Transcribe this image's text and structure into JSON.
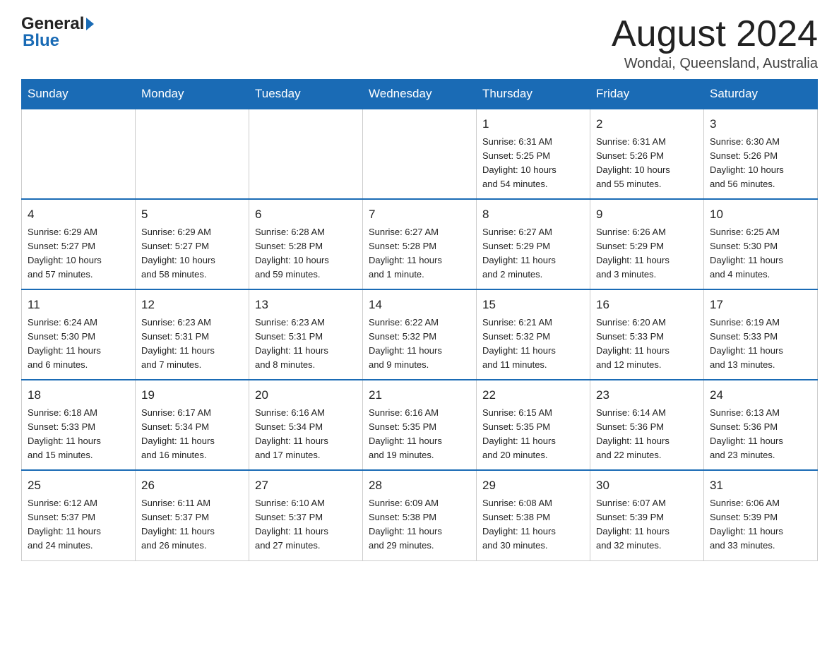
{
  "logo": {
    "general": "General",
    "blue": "Blue"
  },
  "header": {
    "month": "August 2024",
    "location": "Wondai, Queensland, Australia"
  },
  "weekdays": [
    "Sunday",
    "Monday",
    "Tuesday",
    "Wednesday",
    "Thursday",
    "Friday",
    "Saturday"
  ],
  "weeks": [
    [
      {
        "day": "",
        "info": ""
      },
      {
        "day": "",
        "info": ""
      },
      {
        "day": "",
        "info": ""
      },
      {
        "day": "",
        "info": ""
      },
      {
        "day": "1",
        "info": "Sunrise: 6:31 AM\nSunset: 5:25 PM\nDaylight: 10 hours\nand 54 minutes."
      },
      {
        "day": "2",
        "info": "Sunrise: 6:31 AM\nSunset: 5:26 PM\nDaylight: 10 hours\nand 55 minutes."
      },
      {
        "day": "3",
        "info": "Sunrise: 6:30 AM\nSunset: 5:26 PM\nDaylight: 10 hours\nand 56 minutes."
      }
    ],
    [
      {
        "day": "4",
        "info": "Sunrise: 6:29 AM\nSunset: 5:27 PM\nDaylight: 10 hours\nand 57 minutes."
      },
      {
        "day": "5",
        "info": "Sunrise: 6:29 AM\nSunset: 5:27 PM\nDaylight: 10 hours\nand 58 minutes."
      },
      {
        "day": "6",
        "info": "Sunrise: 6:28 AM\nSunset: 5:28 PM\nDaylight: 10 hours\nand 59 minutes."
      },
      {
        "day": "7",
        "info": "Sunrise: 6:27 AM\nSunset: 5:28 PM\nDaylight: 11 hours\nand 1 minute."
      },
      {
        "day": "8",
        "info": "Sunrise: 6:27 AM\nSunset: 5:29 PM\nDaylight: 11 hours\nand 2 minutes."
      },
      {
        "day": "9",
        "info": "Sunrise: 6:26 AM\nSunset: 5:29 PM\nDaylight: 11 hours\nand 3 minutes."
      },
      {
        "day": "10",
        "info": "Sunrise: 6:25 AM\nSunset: 5:30 PM\nDaylight: 11 hours\nand 4 minutes."
      }
    ],
    [
      {
        "day": "11",
        "info": "Sunrise: 6:24 AM\nSunset: 5:30 PM\nDaylight: 11 hours\nand 6 minutes."
      },
      {
        "day": "12",
        "info": "Sunrise: 6:23 AM\nSunset: 5:31 PM\nDaylight: 11 hours\nand 7 minutes."
      },
      {
        "day": "13",
        "info": "Sunrise: 6:23 AM\nSunset: 5:31 PM\nDaylight: 11 hours\nand 8 minutes."
      },
      {
        "day": "14",
        "info": "Sunrise: 6:22 AM\nSunset: 5:32 PM\nDaylight: 11 hours\nand 9 minutes."
      },
      {
        "day": "15",
        "info": "Sunrise: 6:21 AM\nSunset: 5:32 PM\nDaylight: 11 hours\nand 11 minutes."
      },
      {
        "day": "16",
        "info": "Sunrise: 6:20 AM\nSunset: 5:33 PM\nDaylight: 11 hours\nand 12 minutes."
      },
      {
        "day": "17",
        "info": "Sunrise: 6:19 AM\nSunset: 5:33 PM\nDaylight: 11 hours\nand 13 minutes."
      }
    ],
    [
      {
        "day": "18",
        "info": "Sunrise: 6:18 AM\nSunset: 5:33 PM\nDaylight: 11 hours\nand 15 minutes."
      },
      {
        "day": "19",
        "info": "Sunrise: 6:17 AM\nSunset: 5:34 PM\nDaylight: 11 hours\nand 16 minutes."
      },
      {
        "day": "20",
        "info": "Sunrise: 6:16 AM\nSunset: 5:34 PM\nDaylight: 11 hours\nand 17 minutes."
      },
      {
        "day": "21",
        "info": "Sunrise: 6:16 AM\nSunset: 5:35 PM\nDaylight: 11 hours\nand 19 minutes."
      },
      {
        "day": "22",
        "info": "Sunrise: 6:15 AM\nSunset: 5:35 PM\nDaylight: 11 hours\nand 20 minutes."
      },
      {
        "day": "23",
        "info": "Sunrise: 6:14 AM\nSunset: 5:36 PM\nDaylight: 11 hours\nand 22 minutes."
      },
      {
        "day": "24",
        "info": "Sunrise: 6:13 AM\nSunset: 5:36 PM\nDaylight: 11 hours\nand 23 minutes."
      }
    ],
    [
      {
        "day": "25",
        "info": "Sunrise: 6:12 AM\nSunset: 5:37 PM\nDaylight: 11 hours\nand 24 minutes."
      },
      {
        "day": "26",
        "info": "Sunrise: 6:11 AM\nSunset: 5:37 PM\nDaylight: 11 hours\nand 26 minutes."
      },
      {
        "day": "27",
        "info": "Sunrise: 6:10 AM\nSunset: 5:37 PM\nDaylight: 11 hours\nand 27 minutes."
      },
      {
        "day": "28",
        "info": "Sunrise: 6:09 AM\nSunset: 5:38 PM\nDaylight: 11 hours\nand 29 minutes."
      },
      {
        "day": "29",
        "info": "Sunrise: 6:08 AM\nSunset: 5:38 PM\nDaylight: 11 hours\nand 30 minutes."
      },
      {
        "day": "30",
        "info": "Sunrise: 6:07 AM\nSunset: 5:39 PM\nDaylight: 11 hours\nand 32 minutes."
      },
      {
        "day": "31",
        "info": "Sunrise: 6:06 AM\nSunset: 5:39 PM\nDaylight: 11 hours\nand 33 minutes."
      }
    ]
  ]
}
